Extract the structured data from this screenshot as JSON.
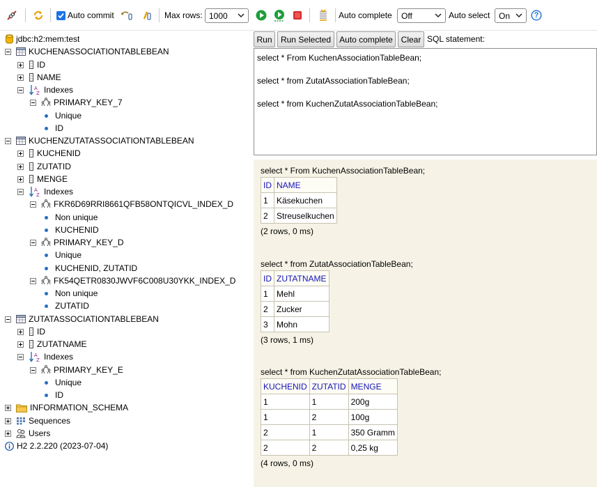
{
  "toolbar": {
    "auto_commit_label": "Auto commit",
    "max_rows_label": "Max rows:",
    "max_rows_value": "1000",
    "auto_complete_label": "Auto complete",
    "auto_complete_value": "Off",
    "auto_select_label": "Auto select",
    "auto_select_value": "On",
    "help_glyph": "?"
  },
  "tree": {
    "connection": "jdbc:h2:mem:test",
    "tables": [
      {
        "name": "KUCHENASSOCIATIONTABLEBEAN",
        "columns": [
          "ID",
          "NAME"
        ],
        "indexes_label": "Indexes",
        "indexes": [
          {
            "name": "PRIMARY_KEY_7",
            "props": [
              "Unique",
              "ID"
            ]
          }
        ]
      },
      {
        "name": "KUCHENZUTATASSOCIATIONTABLEBEAN",
        "columns": [
          "KUCHENID",
          "ZUTATID",
          "MENGE"
        ],
        "indexes_label": "Indexes",
        "indexes": [
          {
            "name": "FKR6D69RRI8661QFB58ONTQICVL_INDEX_D",
            "props": [
              "Non unique",
              "KUCHENID"
            ]
          },
          {
            "name": "PRIMARY_KEY_D",
            "props": [
              "Unique",
              "KUCHENID, ZUTATID"
            ]
          },
          {
            "name": "FK54QETR0830JWVF6C008U30YKK_INDEX_D",
            "props": [
              "Non unique",
              "ZUTATID"
            ]
          }
        ]
      },
      {
        "name": "ZUTATASSOCIATIONTABLEBEAN",
        "columns": [
          "ID",
          "ZUTATNAME"
        ],
        "indexes_label": "Indexes",
        "indexes": [
          {
            "name": "PRIMARY_KEY_E",
            "props": [
              "Unique",
              "ID"
            ]
          }
        ]
      }
    ],
    "information_schema": "INFORMATION_SCHEMA",
    "sequences": "Sequences",
    "users": "Users",
    "version": "H2 2.2.220 (2023-07-04)"
  },
  "sql": {
    "buttons": [
      "Run",
      "Run Selected",
      "Auto complete",
      "Clear"
    ],
    "label": "SQL statement:",
    "lines": [
      "select * From KuchenAssociationTableBean;",
      "",
      "select * from ZutatAssociationTableBean;",
      "",
      "select * from KuchenZutatAssociationTableBean;"
    ]
  },
  "results": [
    {
      "query": "select * From KuchenAssociationTableBean;",
      "headers": [
        "ID",
        "NAME"
      ],
      "rows": [
        [
          "1",
          "Käsekuchen"
        ],
        [
          "2",
          "Streuselkuchen"
        ]
      ],
      "status": "(2 rows, 0 ms)"
    },
    {
      "query": "select * from ZutatAssociationTableBean;",
      "headers": [
        "ID",
        "ZUTATNAME"
      ],
      "rows": [
        [
          "1",
          "Mehl"
        ],
        [
          "2",
          "Zucker"
        ],
        [
          "3",
          "Mohn"
        ]
      ],
      "status": "(3 rows, 1 ms)"
    },
    {
      "query": "select * from KuchenZutatAssociationTableBean;",
      "headers": [
        "KUCHENID",
        "ZUTATID",
        "MENGE"
      ],
      "rows": [
        [
          "1",
          "1",
          "200g"
        ],
        [
          "1",
          "2",
          "100g"
        ],
        [
          "2",
          "1",
          "350 Gramm"
        ],
        [
          "2",
          "2",
          "0,25 kg"
        ]
      ],
      "status": "(4 rows, 0 ms)"
    }
  ],
  "colors": {
    "results_bg": "#f6f3e6",
    "header_text": "#1515b8",
    "run_green": "#1e9e3a",
    "stop_red": "#d42a2a",
    "help_blue": "#1a6fd6"
  }
}
